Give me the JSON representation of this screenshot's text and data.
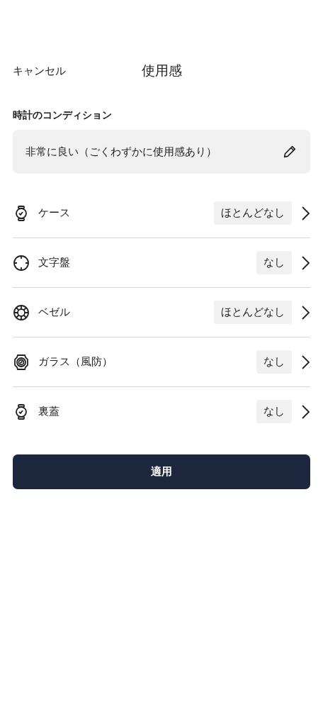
{
  "header": {
    "cancel": "キャンセル",
    "title": "使用感"
  },
  "condition": {
    "label": "時計のコンディション",
    "value": "非常に良い（ごくわずかに使用感あり）"
  },
  "parts": [
    {
      "kind": "case",
      "label": "ケース",
      "value": "ほとんどなし"
    },
    {
      "kind": "dial",
      "label": "文字盤",
      "value": "なし"
    },
    {
      "kind": "bezel",
      "label": "ベゼル",
      "value": "ほとんどなし"
    },
    {
      "kind": "glass",
      "label": "ガラス（風防）",
      "value": "なし"
    },
    {
      "kind": "caseback",
      "label": "裏蓋",
      "value": "なし"
    }
  ],
  "apply_button": "適用"
}
